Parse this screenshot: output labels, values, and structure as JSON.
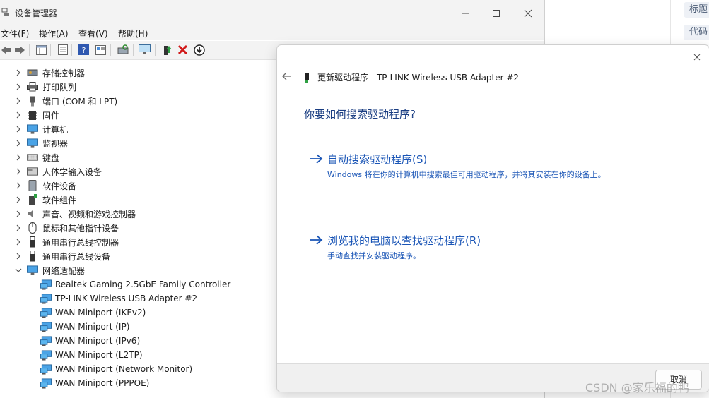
{
  "window": {
    "title": "设备管理器",
    "menu": [
      "文件(F)",
      "操作(A)",
      "查看(V)",
      "帮助(H)"
    ]
  },
  "tree": {
    "categories": [
      {
        "label": "存储控制器",
        "icon": "storage-controller-icon"
      },
      {
        "label": "打印队列",
        "icon": "printer-icon"
      },
      {
        "label": "端口 (COM 和 LPT)",
        "icon": "port-icon"
      },
      {
        "label": "固件",
        "icon": "firmware-icon"
      },
      {
        "label": "计算机",
        "icon": "computer-icon"
      },
      {
        "label": "监视器",
        "icon": "monitor-icon"
      },
      {
        "label": "键盘",
        "icon": "keyboard-icon"
      },
      {
        "label": "人体学输入设备",
        "icon": "hid-icon"
      },
      {
        "label": "软件设备",
        "icon": "software-device-icon"
      },
      {
        "label": "软件组件",
        "icon": "software-component-icon"
      },
      {
        "label": "声音、视频和游戏控制器",
        "icon": "speaker-icon"
      },
      {
        "label": "鼠标和其他指针设备",
        "icon": "mouse-icon"
      },
      {
        "label": "通用串行总线控制器",
        "icon": "usb-icon"
      },
      {
        "label": "通用串行总线设备",
        "icon": "usb-icon"
      },
      {
        "label": "网络适配器",
        "icon": "network-adapter-icon"
      }
    ],
    "network_adapters": [
      "Realtek Gaming 2.5GbE Family Controller",
      "TP-LINK Wireless USB Adapter #2",
      "WAN Miniport (IKEv2)",
      "WAN Miniport (IP)",
      "WAN Miniport (IPv6)",
      "WAN Miniport (L2TP)",
      "WAN Miniport (Network Monitor)",
      "WAN Miniport (PPPOE)"
    ]
  },
  "dialog": {
    "title": "更新驱动程序 - TP-LINK Wireless USB Adapter #2",
    "heading": "你要如何搜索驱动程序?",
    "option_auto": {
      "title": "自动搜索驱动程序(S)",
      "desc": "Windows 将在你的计算机中搜索最佳可用驱动程序，并将其安装在你的设备上。"
    },
    "option_browse": {
      "title": "浏览我的电脑以查找驱动程序(R)",
      "desc": "手动查找并安装驱动程序。"
    },
    "cancel_label": "取消"
  },
  "background_page": {
    "tags": [
      "标题",
      "代码"
    ]
  },
  "watermark": "CSDN @家乐福的鸭",
  "colors": {
    "link_blue": "#1a55b6",
    "heading_blue": "#1a3d82",
    "delete_red": "#d11a1a"
  }
}
